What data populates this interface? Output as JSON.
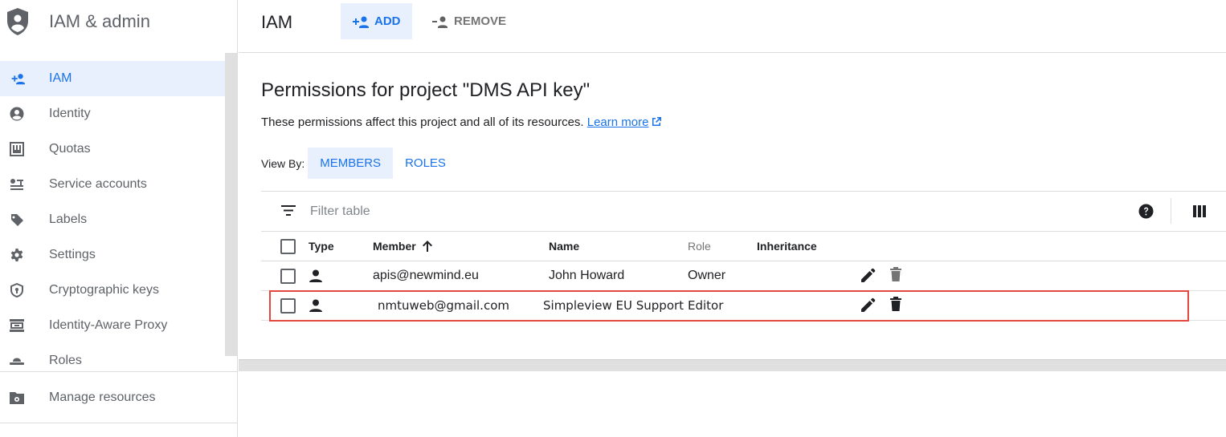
{
  "app": {
    "title": "IAM & admin"
  },
  "sidebar": {
    "items": [
      {
        "label": "IAM",
        "icon": "add-person-icon",
        "active": true
      },
      {
        "label": "Identity",
        "icon": "account-circle-icon"
      },
      {
        "label": "Quotas",
        "icon": "quota-icon"
      },
      {
        "label": "Service accounts",
        "icon": "service-account-icon"
      },
      {
        "label": "Labels",
        "icon": "label-tag-icon"
      },
      {
        "label": "Settings",
        "icon": "gear-icon"
      },
      {
        "label": "Cryptographic keys",
        "icon": "shield-key-icon"
      },
      {
        "label": "Identity-Aware Proxy",
        "icon": "proxy-icon"
      },
      {
        "label": "Roles",
        "icon": "hat-icon"
      }
    ],
    "manage_resources": "Manage resources"
  },
  "header": {
    "title": "IAM",
    "add_label": "ADD",
    "remove_label": "REMOVE"
  },
  "main": {
    "title": "Permissions for project \"DMS API key\"",
    "description": "These permissions affect this project and all of its resources.",
    "learn_more": "Learn more",
    "view_by_label": "View By:",
    "view_by_options": [
      "MEMBERS",
      "ROLES"
    ],
    "view_by_selected": "MEMBERS"
  },
  "table": {
    "filter_placeholder": "Filter table",
    "columns": {
      "type": "Type",
      "member": "Member",
      "name": "Name",
      "role": "Role",
      "inheritance": "Inheritance"
    },
    "rows": [
      {
        "member": "apis@newmind.eu",
        "name": "John Howard",
        "role": "Owner",
        "inheritance": ""
      },
      {
        "member": "nmtuweb@gmail.com",
        "name": "Simpleview EU Support",
        "role": "Editor",
        "inheritance": ""
      }
    ]
  },
  "colors": {
    "accent": "#1a73e8",
    "active_bg": "#e8f0fe",
    "highlight_border": "#e3473d"
  }
}
